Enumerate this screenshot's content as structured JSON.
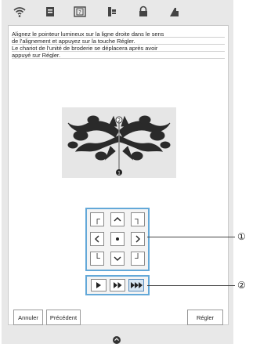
{
  "instructions": {
    "line1": "Alignez le pointeur lumineux sur la ligne droite dans le sens",
    "line2": "de l'alignement et appuyez sur la touche Régler.",
    "line3": "Le chariot de l'unité de broderie se déplacera après avoir",
    "line4": "appuyé sur Régler."
  },
  "pattern": {
    "marker_top": "2",
    "marker_bottom": "1"
  },
  "arrow_keys": {
    "up_left": "┌",
    "up_right": "┐",
    "down_left": "└",
    "down_right": "┘"
  },
  "speed": {
    "selected_level": 3,
    "levels": [
      "slow",
      "medium",
      "fast"
    ]
  },
  "buttons": {
    "cancel": "Annuler",
    "previous": "Précédent",
    "set": "Régler"
  },
  "callouts": {
    "one": "①",
    "two": "②"
  },
  "icons": {
    "wifi": "wifi-icon",
    "page": "page-icon",
    "help": "help-icon",
    "presser_foot": "presser-foot-icon",
    "lock": "lock-icon",
    "needle": "needle-icon",
    "home": "home-icon"
  },
  "colors": {
    "panel_border": "#63a8d8",
    "selected_speed": "#d7e6f2",
    "screen_bg": "#e8e8e8"
  }
}
